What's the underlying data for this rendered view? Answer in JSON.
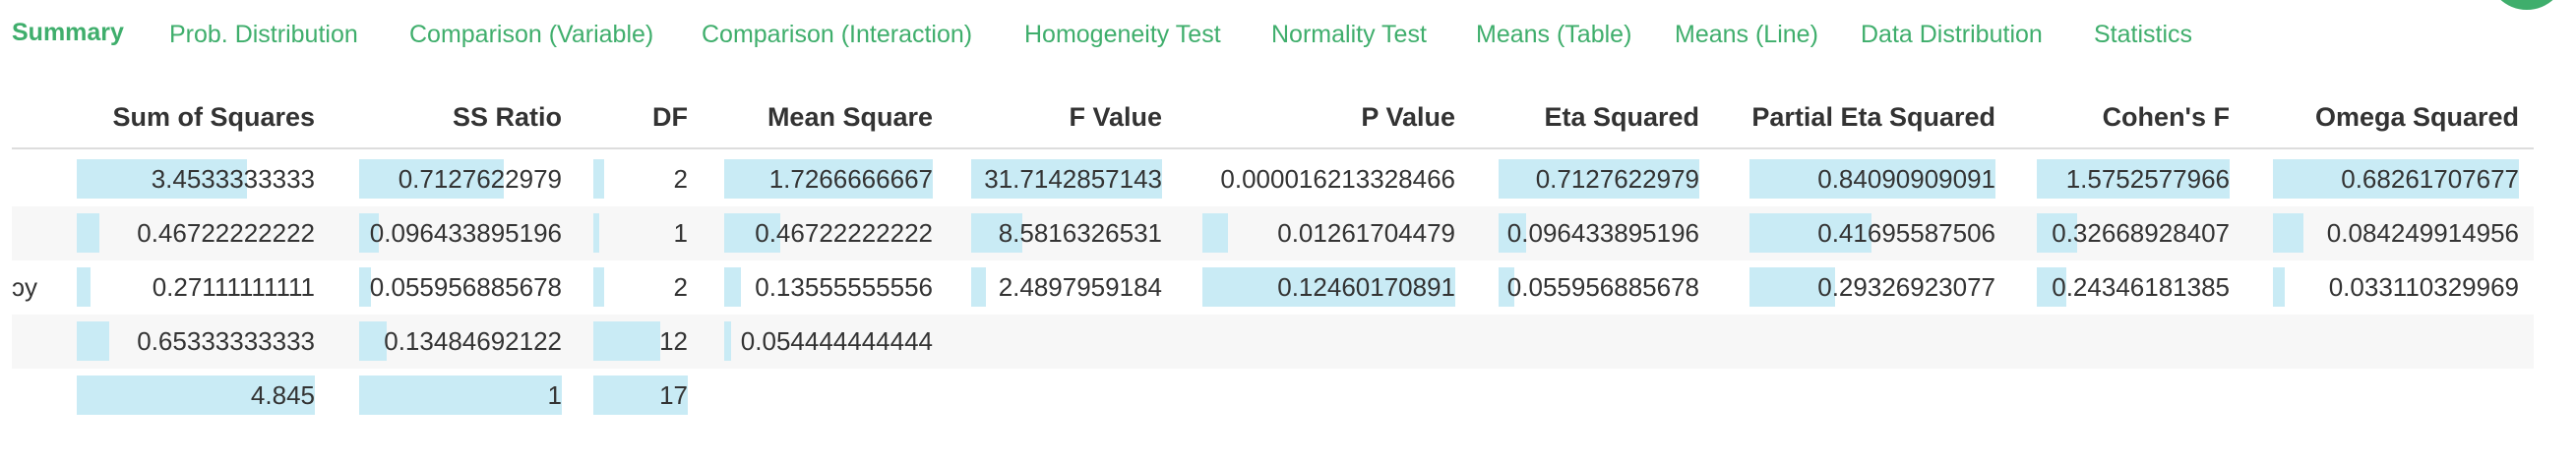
{
  "tabs": [
    {
      "label": "Summary",
      "active": true
    },
    {
      "label": "Prob. Distribution"
    },
    {
      "label": "Comparison (Variable)"
    },
    {
      "label": "Comparison (Interaction)"
    },
    {
      "label": "Homogeneity Test"
    },
    {
      "label": "Normality Test"
    },
    {
      "label": "Means (Table)"
    },
    {
      "label": "Means (Line)"
    },
    {
      "label": "Data Distribution"
    },
    {
      "label": "Statistics"
    }
  ],
  "table": {
    "columns": [
      "Sum of Squares",
      "SS Ratio",
      "DF",
      "Mean Square",
      "F Value",
      "P Value",
      "Eta Squared",
      "Partial Eta Squared",
      "Cohen's F",
      "Omega Squared"
    ],
    "rows": [
      {
        "label": "",
        "cells": [
          {
            "v": "3.4533333333",
            "f": 0.713
          },
          {
            "v": "0.7127622979",
            "f": 0.713
          },
          {
            "v": "2",
            "f": 0.118
          },
          {
            "v": "1.7266666667",
            "f": 1.0
          },
          {
            "v": "31.7142857143",
            "f": 1.0
          },
          {
            "v": "0.000016213328466",
            "f": 0.0
          },
          {
            "v": "0.7127622979",
            "f": 1.0
          },
          {
            "v": "0.84090909091",
            "f": 1.0
          },
          {
            "v": "1.5752577966",
            "f": 1.0
          },
          {
            "v": "0.68261707677",
            "f": 1.0
          }
        ]
      },
      {
        "label": "",
        "cells": [
          {
            "v": "0.46722222222",
            "f": 0.096
          },
          {
            "v": "0.096433895196",
            "f": 0.096
          },
          {
            "v": "1",
            "f": 0.059
          },
          {
            "v": "0.46722222222",
            "f": 0.27
          },
          {
            "v": "8.5816326531",
            "f": 0.27
          },
          {
            "v": "0.01261704479",
            "f": 0.101
          },
          {
            "v": "0.096433895196",
            "f": 0.135
          },
          {
            "v": "0.41695587506",
            "f": 0.496
          },
          {
            "v": "0.32668928407",
            "f": 0.207
          },
          {
            "v": "0.084249914956",
            "f": 0.123
          }
        ]
      },
      {
        "label": "ɔy",
        "cells": [
          {
            "v": "0.27111111111",
            "f": 0.056
          },
          {
            "v": "0.055956885678",
            "f": 0.056
          },
          {
            "v": "2",
            "f": 0.118
          },
          {
            "v": "0.13555555556",
            "f": 0.079
          },
          {
            "v": "2.4897959184",
            "f": 0.079
          },
          {
            "v": "0.12460170891",
            "f": 1.0
          },
          {
            "v": "0.055956885678",
            "f": 0.079
          },
          {
            "v": "0.29326923077",
            "f": 0.349
          },
          {
            "v": "0.24346181385",
            "f": 0.155
          },
          {
            "v": "0.033110329969",
            "f": 0.049
          }
        ]
      },
      {
        "label": "",
        "cells": [
          {
            "v": "0.65333333333",
            "f": 0.135
          },
          {
            "v": "0.13484692122",
            "f": 0.135
          },
          {
            "v": "12",
            "f": 0.706
          },
          {
            "v": "0.054444444444",
            "f": 0.032
          }
        ]
      },
      {
        "label": "",
        "cells": [
          {
            "v": "4.845",
            "f": 1.0
          },
          {
            "v": "1",
            "f": 1.0
          },
          {
            "v": "17",
            "f": 1.0
          }
        ]
      }
    ]
  }
}
